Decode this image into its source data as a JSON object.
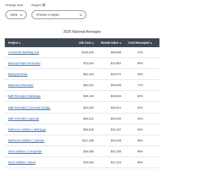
{
  "filters": {
    "year_label": "Change Year:",
    "year_value": "2025",
    "region_label": "Region:",
    "region_info": "i",
    "region_value": "Choose a region"
  },
  "table": {
    "title": "2025 National Averages",
    "headers": {
      "project": "Project",
      "job_cost": "Job Cost",
      "resale_value": "Resale Value",
      "cost_recouped": "Cost Recouped"
    },
    "rows": [
      {
        "project": "Accessory Dwelling Unit",
        "job_cost": "$166,406",
        "resale_value": "$68,856",
        "cost_recouped": "41%"
      },
      {
        "project": "Backup Power Generator",
        "job_cost": "$13,534",
        "resale_value": "$12,862",
        "cost_recouped": "95%"
      },
      {
        "project": "Backyard Patio",
        "job_cost": "$51,464",
        "resale_value": "$23,672",
        "cost_recouped": "46%"
      },
      {
        "project": "Basement Remodel",
        "job_cost": "$52,012",
        "resale_value": "$36,905",
        "cost_recouped": "71%"
      },
      {
        "project": "Bath Remodel | Midrange",
        "job_cost": "$26,138",
        "resale_value": "$20,865",
        "cost_recouped": "80%"
      },
      {
        "project": "Bath Remodel | Universal Design",
        "job_cost": "$42,333",
        "resale_value": "$25,812",
        "cost_recouped": "61%"
      },
      {
        "project": "Bath Remodel | Upscale",
        "job_cost": "$81,612",
        "resale_value": "$34,000",
        "cost_recouped": "42%"
      },
      {
        "project": "Bathroom Addition | Midrange",
        "job_cost": "$60,845",
        "resale_value": "$32,347",
        "cost_recouped": "53%"
      },
      {
        "project": "Bathroom Addition | Upscale",
        "job_cost": "$111,255",
        "resale_value": "$40,528",
        "cost_recouped": "36%"
      },
      {
        "project": "Deck Addition | Composite",
        "job_cost": "$25,086",
        "resale_value": "$22,199",
        "cost_recouped": "89%"
      },
      {
        "project": "Deck Addition | Wood",
        "job_cost": "$18,263",
        "resale_value": "$17,323",
        "cost_recouped": "95%"
      }
    ]
  }
}
